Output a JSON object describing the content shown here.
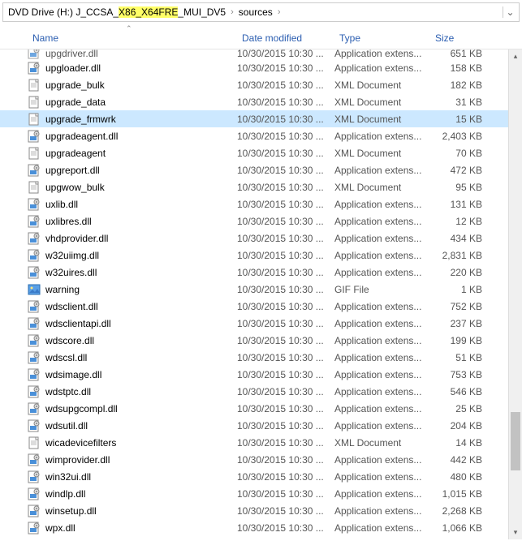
{
  "breadcrumb": {
    "drive_prefix": "DVD Drive (H:) J_CCSA_",
    "drive_highlight": "X86_X64FRE",
    "drive_suffix": "_MUI_DV5",
    "folder": "sources"
  },
  "columns": {
    "name": "Name",
    "date": "Date modified",
    "type": "Type",
    "size": "Size"
  },
  "icons": {
    "dll": "dll",
    "xml": "xml",
    "gif": "gif"
  },
  "files": [
    {
      "name": "upgdriver.dll",
      "date": "10/30/2015 10:30 ...",
      "type": "Application extens...",
      "size": "651 KB",
      "icon": "dll",
      "cut": true
    },
    {
      "name": "upgloader.dll",
      "date": "10/30/2015 10:30 ...",
      "type": "Application extens...",
      "size": "158 KB",
      "icon": "dll"
    },
    {
      "name": "upgrade_bulk",
      "date": "10/30/2015 10:30 ...",
      "type": "XML Document",
      "size": "182 KB",
      "icon": "xml"
    },
    {
      "name": "upgrade_data",
      "date": "10/30/2015 10:30 ...",
      "type": "XML Document",
      "size": "31 KB",
      "icon": "xml"
    },
    {
      "name": "upgrade_frmwrk",
      "date": "10/30/2015 10:30 ...",
      "type": "XML Document",
      "size": "15 KB",
      "icon": "xml",
      "selected": true
    },
    {
      "name": "upgradeagent.dll",
      "date": "10/30/2015 10:30 ...",
      "type": "Application extens...",
      "size": "2,403 KB",
      "icon": "dll"
    },
    {
      "name": "upgradeagent",
      "date": "10/30/2015 10:30 ...",
      "type": "XML Document",
      "size": "70 KB",
      "icon": "xml"
    },
    {
      "name": "upgreport.dll",
      "date": "10/30/2015 10:30 ...",
      "type": "Application extens...",
      "size": "472 KB",
      "icon": "dll"
    },
    {
      "name": "upgwow_bulk",
      "date": "10/30/2015 10:30 ...",
      "type": "XML Document",
      "size": "95 KB",
      "icon": "xml"
    },
    {
      "name": "uxlib.dll",
      "date": "10/30/2015 10:30 ...",
      "type": "Application extens...",
      "size": "131 KB",
      "icon": "dll"
    },
    {
      "name": "uxlibres.dll",
      "date": "10/30/2015 10:30 ...",
      "type": "Application extens...",
      "size": "12 KB",
      "icon": "dll"
    },
    {
      "name": "vhdprovider.dll",
      "date": "10/30/2015 10:30 ...",
      "type": "Application extens...",
      "size": "434 KB",
      "icon": "dll"
    },
    {
      "name": "w32uiimg.dll",
      "date": "10/30/2015 10:30 ...",
      "type": "Application extens...",
      "size": "2,831 KB",
      "icon": "dll"
    },
    {
      "name": "w32uires.dll",
      "date": "10/30/2015 10:30 ...",
      "type": "Application extens...",
      "size": "220 KB",
      "icon": "dll"
    },
    {
      "name": "warning",
      "date": "10/30/2015 10:30 ...",
      "type": "GIF File",
      "size": "1 KB",
      "icon": "gif"
    },
    {
      "name": "wdsclient.dll",
      "date": "10/30/2015 10:30 ...",
      "type": "Application extens...",
      "size": "752 KB",
      "icon": "dll"
    },
    {
      "name": "wdsclientapi.dll",
      "date": "10/30/2015 10:30 ...",
      "type": "Application extens...",
      "size": "237 KB",
      "icon": "dll"
    },
    {
      "name": "wdscore.dll",
      "date": "10/30/2015 10:30 ...",
      "type": "Application extens...",
      "size": "199 KB",
      "icon": "dll"
    },
    {
      "name": "wdscsl.dll",
      "date": "10/30/2015 10:30 ...",
      "type": "Application extens...",
      "size": "51 KB",
      "icon": "dll"
    },
    {
      "name": "wdsimage.dll",
      "date": "10/30/2015 10:30 ...",
      "type": "Application extens...",
      "size": "753 KB",
      "icon": "dll"
    },
    {
      "name": "wdstptc.dll",
      "date": "10/30/2015 10:30 ...",
      "type": "Application extens...",
      "size": "546 KB",
      "icon": "dll"
    },
    {
      "name": "wdsupgcompl.dll",
      "date": "10/30/2015 10:30 ...",
      "type": "Application extens...",
      "size": "25 KB",
      "icon": "dll"
    },
    {
      "name": "wdsutil.dll",
      "date": "10/30/2015 10:30 ...",
      "type": "Application extens...",
      "size": "204 KB",
      "icon": "dll"
    },
    {
      "name": "wicadevicefilters",
      "date": "10/30/2015 10:30 ...",
      "type": "XML Document",
      "size": "14 KB",
      "icon": "xml"
    },
    {
      "name": "wimprovider.dll",
      "date": "10/30/2015 10:30 ...",
      "type": "Application extens...",
      "size": "442 KB",
      "icon": "dll"
    },
    {
      "name": "win32ui.dll",
      "date": "10/30/2015 10:30 ...",
      "type": "Application extens...",
      "size": "480 KB",
      "icon": "dll"
    },
    {
      "name": "windlp.dll",
      "date": "10/30/2015 10:30 ...",
      "type": "Application extens...",
      "size": "1,015 KB",
      "icon": "dll"
    },
    {
      "name": "winsetup.dll",
      "date": "10/30/2015 10:30 ...",
      "type": "Application extens...",
      "size": "2,268 KB",
      "icon": "dll"
    },
    {
      "name": "wpx.dll",
      "date": "10/30/2015 10:30 ...",
      "type": "Application extens...",
      "size": "1,066 KB",
      "icon": "dll"
    }
  ]
}
